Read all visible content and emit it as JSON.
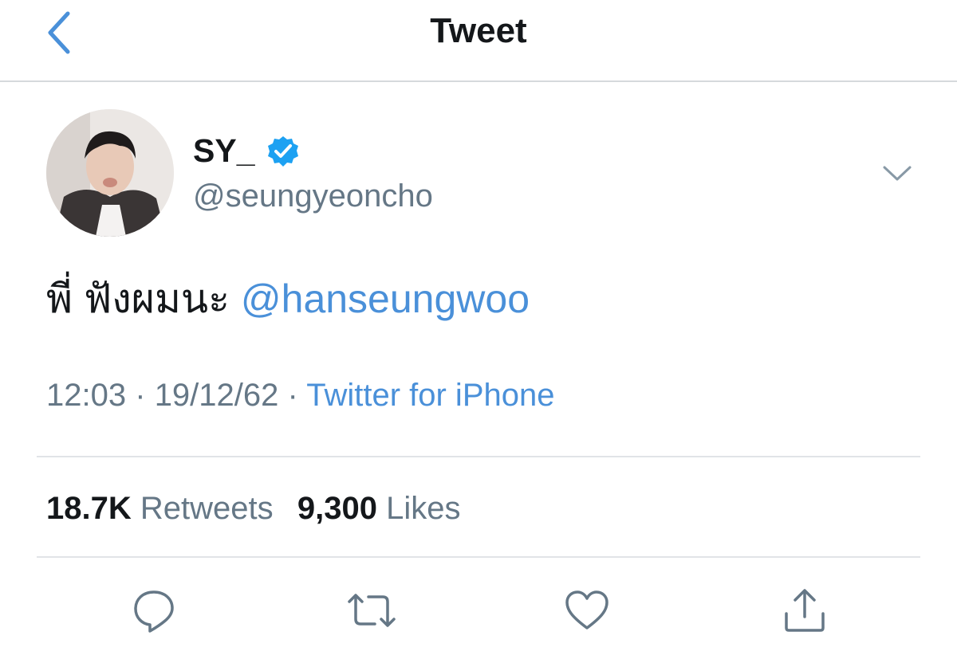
{
  "header": {
    "title": "Tweet",
    "back_icon": "chevron-left-icon"
  },
  "tweet": {
    "author": {
      "display_name": "SY_",
      "handle": "@seungyeoncho",
      "verified": true
    },
    "text": "พี่ ฟังผมนะ",
    "mention": "@hanseungwoo",
    "time": "12:03",
    "date": "19/12/62",
    "separator": "·",
    "source": "Twitter for iPhone",
    "stats": {
      "retweets_count": "18.7K",
      "retweets_label": "Retweets",
      "likes_count": "9,300",
      "likes_label": "Likes"
    }
  },
  "actions": [
    "reply-icon",
    "retweet-icon",
    "like-icon",
    "share-icon"
  ],
  "colors": {
    "accent": "#4a90d9",
    "verified": "#1da1f2",
    "secondary_text": "#657786",
    "primary_text": "#14171a",
    "divider": "#e1e4e7"
  }
}
